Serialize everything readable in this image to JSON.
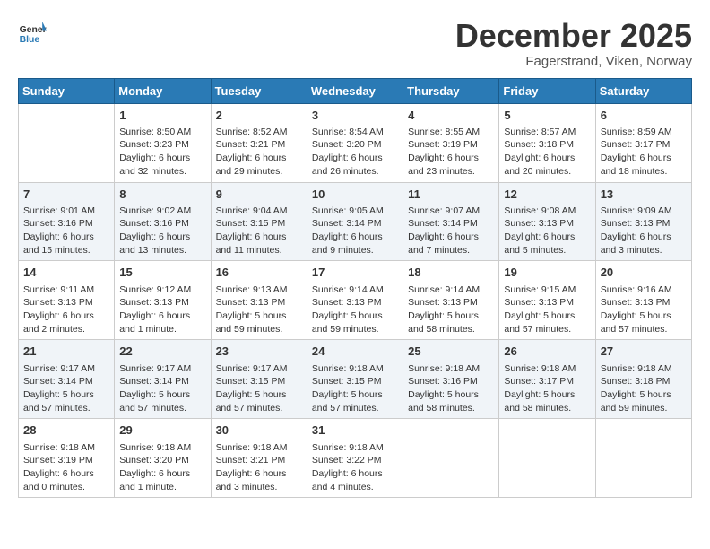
{
  "header": {
    "logo_general": "General",
    "logo_blue": "Blue",
    "month_title": "December 2025",
    "location": "Fagerstrand, Viken, Norway"
  },
  "days_of_week": [
    "Sunday",
    "Monday",
    "Tuesday",
    "Wednesday",
    "Thursday",
    "Friday",
    "Saturday"
  ],
  "weeks": [
    [
      {
        "day": "",
        "info": ""
      },
      {
        "day": "1",
        "info": "Sunrise: 8:50 AM\nSunset: 3:23 PM\nDaylight: 6 hours\nand 32 minutes."
      },
      {
        "day": "2",
        "info": "Sunrise: 8:52 AM\nSunset: 3:21 PM\nDaylight: 6 hours\nand 29 minutes."
      },
      {
        "day": "3",
        "info": "Sunrise: 8:54 AM\nSunset: 3:20 PM\nDaylight: 6 hours\nand 26 minutes."
      },
      {
        "day": "4",
        "info": "Sunrise: 8:55 AM\nSunset: 3:19 PM\nDaylight: 6 hours\nand 23 minutes."
      },
      {
        "day": "5",
        "info": "Sunrise: 8:57 AM\nSunset: 3:18 PM\nDaylight: 6 hours\nand 20 minutes."
      },
      {
        "day": "6",
        "info": "Sunrise: 8:59 AM\nSunset: 3:17 PM\nDaylight: 6 hours\nand 18 minutes."
      }
    ],
    [
      {
        "day": "7",
        "info": "Sunrise: 9:01 AM\nSunset: 3:16 PM\nDaylight: 6 hours\nand 15 minutes."
      },
      {
        "day": "8",
        "info": "Sunrise: 9:02 AM\nSunset: 3:16 PM\nDaylight: 6 hours\nand 13 minutes."
      },
      {
        "day": "9",
        "info": "Sunrise: 9:04 AM\nSunset: 3:15 PM\nDaylight: 6 hours\nand 11 minutes."
      },
      {
        "day": "10",
        "info": "Sunrise: 9:05 AM\nSunset: 3:14 PM\nDaylight: 6 hours\nand 9 minutes."
      },
      {
        "day": "11",
        "info": "Sunrise: 9:07 AM\nSunset: 3:14 PM\nDaylight: 6 hours\nand 7 minutes."
      },
      {
        "day": "12",
        "info": "Sunrise: 9:08 AM\nSunset: 3:13 PM\nDaylight: 6 hours\nand 5 minutes."
      },
      {
        "day": "13",
        "info": "Sunrise: 9:09 AM\nSunset: 3:13 PM\nDaylight: 6 hours\nand 3 minutes."
      }
    ],
    [
      {
        "day": "14",
        "info": "Sunrise: 9:11 AM\nSunset: 3:13 PM\nDaylight: 6 hours\nand 2 minutes."
      },
      {
        "day": "15",
        "info": "Sunrise: 9:12 AM\nSunset: 3:13 PM\nDaylight: 6 hours\nand 1 minute."
      },
      {
        "day": "16",
        "info": "Sunrise: 9:13 AM\nSunset: 3:13 PM\nDaylight: 5 hours\nand 59 minutes."
      },
      {
        "day": "17",
        "info": "Sunrise: 9:14 AM\nSunset: 3:13 PM\nDaylight: 5 hours\nand 59 minutes."
      },
      {
        "day": "18",
        "info": "Sunrise: 9:14 AM\nSunset: 3:13 PM\nDaylight: 5 hours\nand 58 minutes."
      },
      {
        "day": "19",
        "info": "Sunrise: 9:15 AM\nSunset: 3:13 PM\nDaylight: 5 hours\nand 57 minutes."
      },
      {
        "day": "20",
        "info": "Sunrise: 9:16 AM\nSunset: 3:13 PM\nDaylight: 5 hours\nand 57 minutes."
      }
    ],
    [
      {
        "day": "21",
        "info": "Sunrise: 9:17 AM\nSunset: 3:14 PM\nDaylight: 5 hours\nand 57 minutes."
      },
      {
        "day": "22",
        "info": "Sunrise: 9:17 AM\nSunset: 3:14 PM\nDaylight: 5 hours\nand 57 minutes."
      },
      {
        "day": "23",
        "info": "Sunrise: 9:17 AM\nSunset: 3:15 PM\nDaylight: 5 hours\nand 57 minutes."
      },
      {
        "day": "24",
        "info": "Sunrise: 9:18 AM\nSunset: 3:15 PM\nDaylight: 5 hours\nand 57 minutes."
      },
      {
        "day": "25",
        "info": "Sunrise: 9:18 AM\nSunset: 3:16 PM\nDaylight: 5 hours\nand 58 minutes."
      },
      {
        "day": "26",
        "info": "Sunrise: 9:18 AM\nSunset: 3:17 PM\nDaylight: 5 hours\nand 58 minutes."
      },
      {
        "day": "27",
        "info": "Sunrise: 9:18 AM\nSunset: 3:18 PM\nDaylight: 5 hours\nand 59 minutes."
      }
    ],
    [
      {
        "day": "28",
        "info": "Sunrise: 9:18 AM\nSunset: 3:19 PM\nDaylight: 6 hours\nand 0 minutes."
      },
      {
        "day": "29",
        "info": "Sunrise: 9:18 AM\nSunset: 3:20 PM\nDaylight: 6 hours\nand 1 minute."
      },
      {
        "day": "30",
        "info": "Sunrise: 9:18 AM\nSunset: 3:21 PM\nDaylight: 6 hours\nand 3 minutes."
      },
      {
        "day": "31",
        "info": "Sunrise: 9:18 AM\nSunset: 3:22 PM\nDaylight: 6 hours\nand 4 minutes."
      },
      {
        "day": "",
        "info": ""
      },
      {
        "day": "",
        "info": ""
      },
      {
        "day": "",
        "info": ""
      }
    ]
  ]
}
